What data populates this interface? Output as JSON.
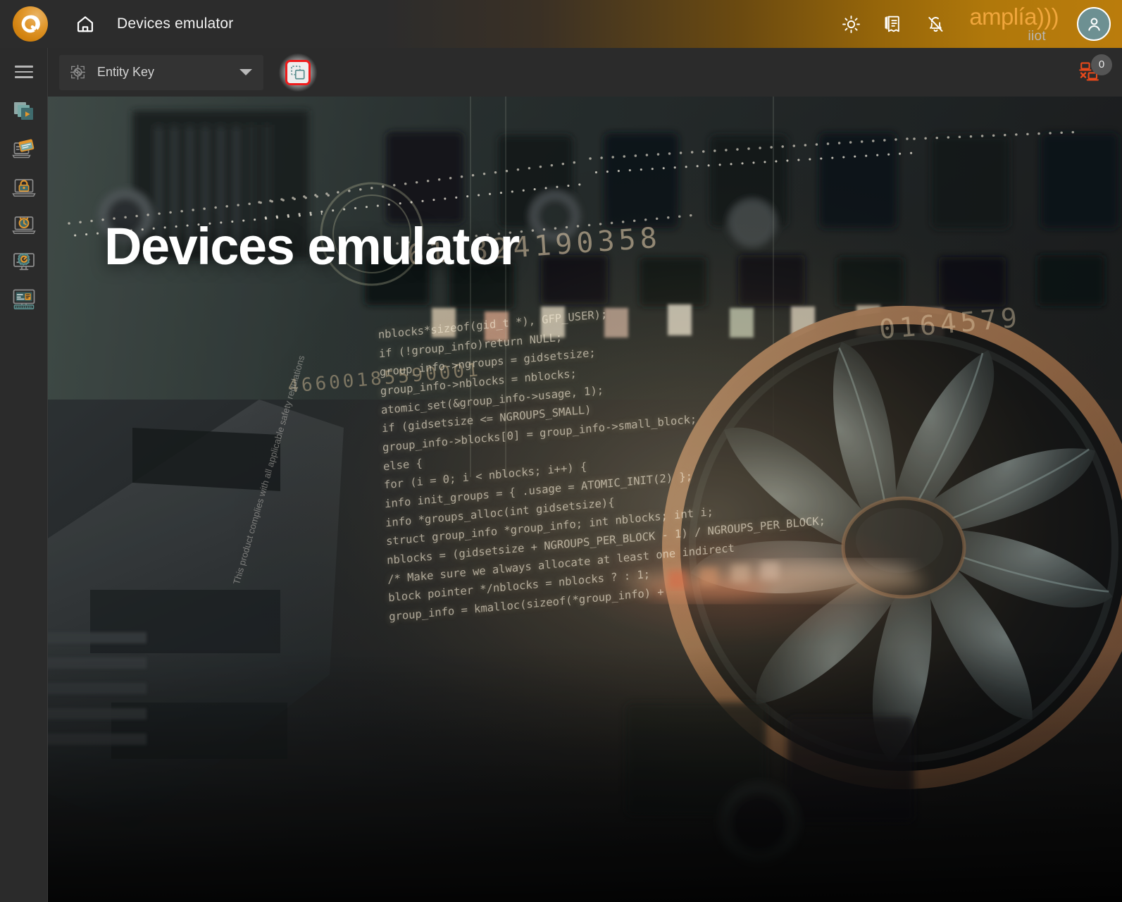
{
  "header": {
    "brand_icon": "amplia-circle-logo",
    "home_icon": "home-icon",
    "title": "Devices emulator",
    "icons": [
      {
        "name": "brightness-icon",
        "label": "Brightness"
      },
      {
        "name": "changelog-icon",
        "label": "Release notes"
      },
      {
        "name": "bell-off-icon",
        "label": "Notifications muted"
      }
    ],
    "logo": {
      "main": "amplía)))",
      "sub": "iiot"
    },
    "avatar_icon": "user-avatar-icon"
  },
  "sidebar": {
    "menu_toggle": "hamburger-icon",
    "items": [
      {
        "name": "sidebar-item-simulations",
        "icon": "stacked-play-icon",
        "label": "Simulations"
      },
      {
        "name": "sidebar-item-templates",
        "icon": "laptop-document-icon",
        "label": "Templates"
      },
      {
        "name": "sidebar-item-security",
        "icon": "laptop-lock-icon",
        "label": "Security"
      },
      {
        "name": "sidebar-item-scheduling",
        "icon": "laptop-clock-icon",
        "label": "Scheduling"
      },
      {
        "name": "sidebar-item-settings",
        "icon": "monitor-gear-icon",
        "label": "Settings"
      },
      {
        "name": "sidebar-item-console",
        "icon": "terminal-keyboard-icon",
        "label": "Console"
      }
    ]
  },
  "toolbar": {
    "entity_select": {
      "icon": "target-crosshair-icon",
      "value": "Entity Key",
      "placeholder": "Entity Key",
      "caret": "chevron-down-icon",
      "options": [
        "Entity Key"
      ]
    },
    "duplicate_button": {
      "icon": "duplicate-icon",
      "label": "Duplicate",
      "highlight_color": "#ef1b1b",
      "icon_color": "#5c8f90"
    },
    "disconnected_devices": {
      "icon": "devices-disconnected-icon",
      "count": "0",
      "color": "#e8491b"
    }
  },
  "hero": {
    "title": "Devices emulator",
    "code_overlay": "nblocks*sizeof(gid_t *), GFP_USER);\nif (!group_info)return NULL;\ngroup_info->ngroups = gidsetsize;\ngroup_info->nblocks = nblocks;\natomic_set(&group_info->usage, 1);\nif (gidsetsize <= NGROUPS_SMALL)\ngroup_info->blocks[0] = group_info->small_block;\nelse {\nfor (i = 0; i < nblocks; i++) {\ninfo init_groups = { .usage = ATOMIC_INIT(2) };\ninfo *groups_alloc(int gidsetsize){\nstruct group_info *group_info; int nblocks; int i;\nnblocks = (gidsetsize + NGROUPS_PER_BLOCK - 1) / NGROUPS_PER_BLOCK;\n/* Make sure we always allocate at least one indirect\nblock pointer */nblocks = nblocks ? : 1;\ngroup_info = kmalloc(sizeof(*group_info) +",
    "digits_top": "61  824190358",
    "digits_bottom": "46600185590001",
    "digits_right": "0164579",
    "board_text": "This product complies with all applicable safety regulations"
  },
  "colors": {
    "accent_orange": "#e2992f",
    "logo_orange": "#f0a63c",
    "header_dark": "#2c2c2c",
    "sidebar_bg": "#2b2b2b",
    "toolbar_bg": "#2b2b2b",
    "avatar_teal": "#6d9092",
    "highlight_red": "#ef1b1b",
    "alert_orange": "#e8491b"
  }
}
